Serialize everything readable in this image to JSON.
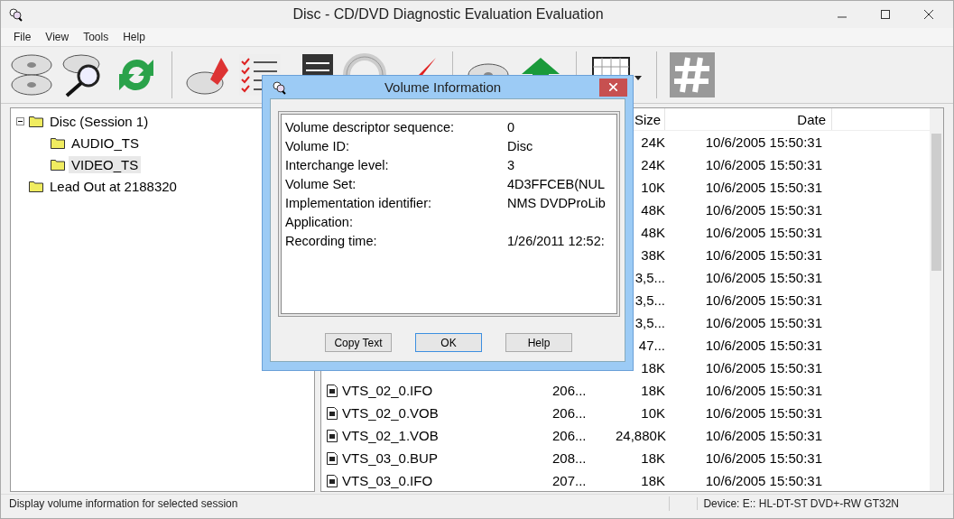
{
  "window": {
    "title": "Disc - CD/DVD Diagnostic Evaluation Evaluation"
  },
  "menu": [
    "File",
    "View",
    "Tools",
    "Help"
  ],
  "tree": [
    {
      "label": "Disc (Session 1)",
      "expanded": true,
      "selected": false,
      "children": [
        {
          "label": "AUDIO_TS",
          "selected": false
        },
        {
          "label": "VIDEO_TS",
          "selected": true
        }
      ]
    },
    {
      "label": "Lead Out at 2188320",
      "selected": false
    }
  ],
  "file_list": {
    "columns": [
      "Size",
      "Date"
    ],
    "rows": [
      {
        "size": "24K",
        "date": "10/6/2005 15:50:31"
      },
      {
        "size": "24K",
        "date": "10/6/2005 15:50:31"
      },
      {
        "size": "10K",
        "date": "10/6/2005 15:50:31"
      },
      {
        "size": "48K",
        "date": "10/6/2005 15:50:31"
      },
      {
        "size": "48K",
        "date": "10/6/2005 15:50:31"
      },
      {
        "size": "38K",
        "date": "10/6/2005 15:50:31"
      },
      {
        "size": "3,5...",
        "date": "10/6/2005 15:50:31"
      },
      {
        "size": "3,5...",
        "date": "10/6/2005 15:50:31"
      },
      {
        "size": "3,5...",
        "date": "10/6/2005 15:50:31"
      },
      {
        "size": "47...",
        "date": "10/6/2005 15:50:31"
      },
      {
        "size": "18K",
        "date": "10/6/2005 15:50:31"
      },
      {
        "name": "VTS_02_0.IFO",
        "column_2": "206...",
        "size": "18K",
        "date": "10/6/2005 15:50:31"
      },
      {
        "name": "VTS_02_0.VOB",
        "column_2": "206...",
        "size": "10K",
        "date": "10/6/2005 15:50:31"
      },
      {
        "name": "VTS_02_1.VOB",
        "column_2": "206...",
        "size": "24,880K",
        "date": "10/6/2005 15:50:31"
      },
      {
        "name": "VTS_03_0.BUP",
        "column_2": "208...",
        "size": "18K",
        "date": "10/6/2005 15:50:31"
      },
      {
        "name": "VTS_03_0.IFO",
        "column_2": "207...",
        "size": "18K",
        "date": "10/6/2005 15:50:31"
      }
    ]
  },
  "dialog": {
    "title": "Volume Information",
    "fields": [
      {
        "label": "Volume descriptor sequence:",
        "value": "0"
      },
      {
        "label": "Volume ID:",
        "value": "Disc"
      },
      {
        "label": "Interchange level:",
        "value": "3"
      },
      {
        "label": "Volume Set:",
        "value": "4D3FFCEB(NUL"
      },
      {
        "label": "Implementation identifier:",
        "value": "NMS DVDProLib"
      },
      {
        "label": "Application:"
      },
      {
        "label": "Recording time:",
        "value": "1/26/2011 12:52:"
      }
    ],
    "buttons": [
      {
        "label": "Copy Text",
        "default": false
      },
      {
        "label": "OK",
        "default": true
      },
      {
        "label": "Help",
        "default": false
      }
    ]
  },
  "status_bar": {
    "message": "Display volume information for selected session",
    "device": "Device: E:: HL-DT-ST DVD+-RW GT32N"
  }
}
